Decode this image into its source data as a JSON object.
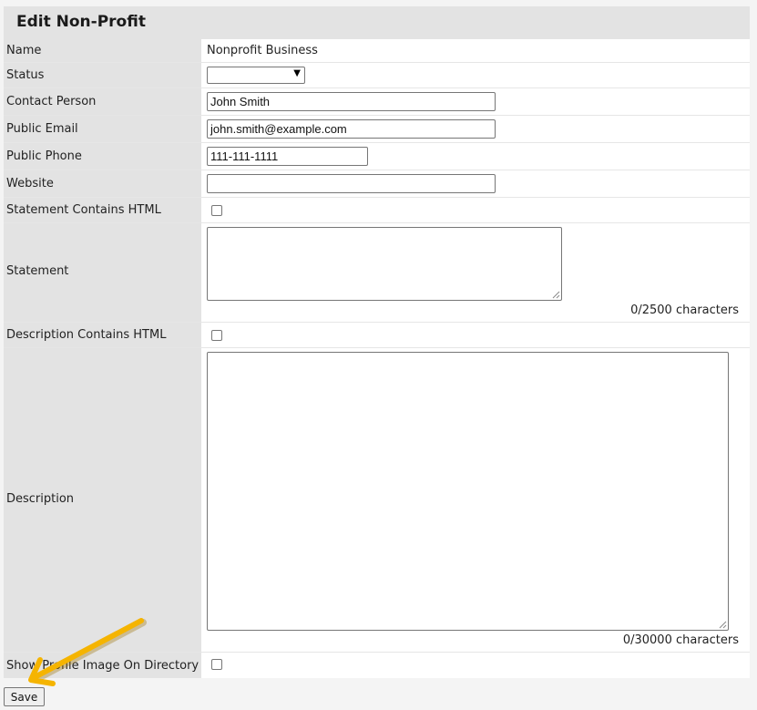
{
  "form": {
    "title": "Edit Non-Profit",
    "fields": {
      "name": {
        "label": "Name",
        "value": "Nonprofit Business"
      },
      "status": {
        "label": "Status",
        "value": ""
      },
      "contact_person": {
        "label": "Contact Person",
        "value": "John Smith"
      },
      "public_email": {
        "label": "Public Email",
        "value": "john.smith@example.com"
      },
      "public_phone": {
        "label": "Public Phone",
        "value": "111-111-1111"
      },
      "website": {
        "label": "Website",
        "value": ""
      },
      "statement_html": {
        "label": "Statement Contains HTML",
        "checked": false
      },
      "statement": {
        "label": "Statement",
        "value": "",
        "counter": "0/2500 characters"
      },
      "description_html": {
        "label": "Description Contains HTML",
        "checked": false
      },
      "description": {
        "label": "Description",
        "value": "",
        "counter": "0/30000 characters"
      },
      "show_profile_image": {
        "label": "Show Profile Image On Directory",
        "checked": false
      }
    },
    "save_label": "Save"
  },
  "colors": {
    "label_bg": "#e3e3e3",
    "annotation_arrow": "#f5b400"
  }
}
